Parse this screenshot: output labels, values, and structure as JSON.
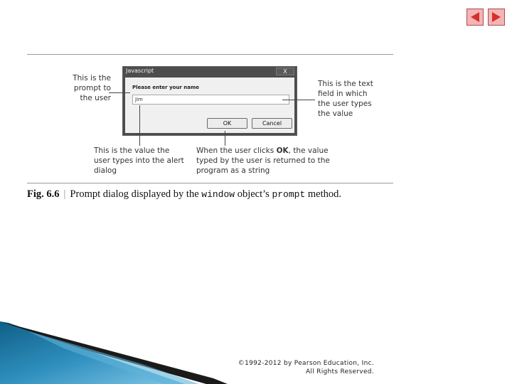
{
  "nav": {
    "prev_icon": "arrow-left-icon",
    "next_icon": "arrow-right-icon",
    "fill": "#f3b5b5",
    "arrow": "#d62e2e"
  },
  "dialog": {
    "title": "Javascript",
    "close_label": "X",
    "message": "Please enter your name",
    "input_value": "Jim",
    "ok_label": "OK",
    "cancel_label": "Cancel"
  },
  "callouts": {
    "prompt": "This is the prompt to the user",
    "text_field": "This is the text field in which the user types the value",
    "value_typed": "This is the value the user types into the alert dialog",
    "ok_clicked_before": "When the user clicks ",
    "ok_clicked_key": "OK",
    "ok_clicked_after": ", the value typed by the user is returned to the program as a string"
  },
  "caption": {
    "figure": "Fig. 6.6",
    "separator": "|",
    "text_before": "Prompt dialog displayed by the ",
    "code1": "window",
    "text_middle": " object’s ",
    "code2": "prompt",
    "text_after": " method."
  },
  "footer": {
    "line1": "©1992-2012 by Pearson Education, Inc.",
    "line2": "All Rights Reserved."
  }
}
